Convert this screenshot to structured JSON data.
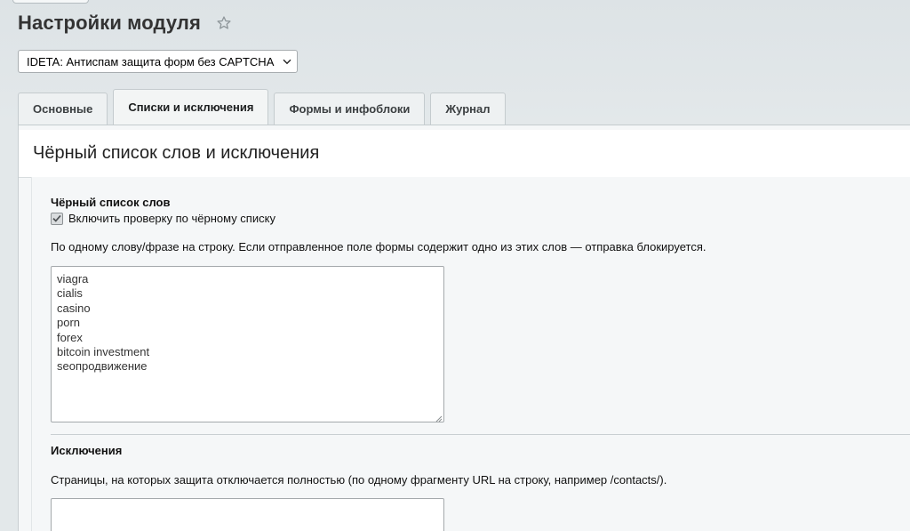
{
  "page": {
    "title": "Настройки модуля"
  },
  "module_select": {
    "selected": "IDETA: Антиспам защита форм без CAPTCHA"
  },
  "tabs": [
    {
      "label": "Основные",
      "active": false
    },
    {
      "label": "Списки и исключения",
      "active": true
    },
    {
      "label": "Формы и инфоблоки",
      "active": false
    },
    {
      "label": "Журнал",
      "active": false
    }
  ],
  "section": {
    "title": "Чёрный список слов и исключения"
  },
  "blacklist": {
    "title": "Чёрный список слов",
    "checkbox_label": "Включить проверку по чёрному списку",
    "checkbox_checked": true,
    "hint": "По одному слову/фразе на строку. Если отправленное поле формы содержит одно из этих слов — отправка блокируется.",
    "words": [
      "viagra",
      "cialis",
      "casino",
      "porn",
      "forex",
      "bitcoin investment",
      "seoпродвижение"
    ]
  },
  "exclusions": {
    "title": "Исключения",
    "hint": "Страницы, на которых защита отключается полностью (по одному фрагменту URL на строку, например /contacts/).",
    "value": ""
  },
  "icons": {
    "favorite": "star-icon",
    "select_arrow": "chevron-down-icon",
    "checkbox_mark": "checkmark-icon",
    "textarea_resize": "resize-handle-icon"
  },
  "colors": {
    "background": "#e1e6e8",
    "panel": "#f5f7f8",
    "header": "#ffffff",
    "border": "#c4cbce"
  }
}
